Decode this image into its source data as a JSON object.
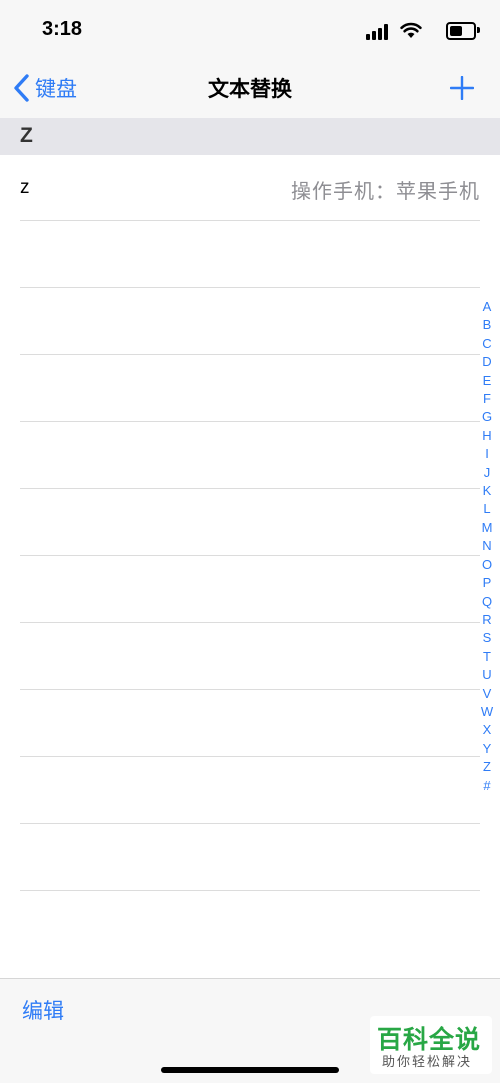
{
  "status": {
    "time": "3:18"
  },
  "nav": {
    "back_label": "键盘",
    "title": "文本替换"
  },
  "section": {
    "header": "Z"
  },
  "entries": [
    {
      "shortcut": "z",
      "phrase": "操作手机：苹果手机"
    }
  ],
  "index_letters": [
    "A",
    "B",
    "C",
    "D",
    "E",
    "F",
    "G",
    "H",
    "I",
    "J",
    "K",
    "L",
    "M",
    "N",
    "O",
    "P",
    "Q",
    "R",
    "S",
    "T",
    "U",
    "V",
    "W",
    "X",
    "Y",
    "Z",
    "#"
  ],
  "toolbar": {
    "edit_label": "编辑"
  },
  "watermark": {
    "title": "百科全说",
    "subtitle": "助你轻松解决"
  },
  "colors": {
    "accent": "#2f7cf6",
    "watermark": "#28a745"
  }
}
